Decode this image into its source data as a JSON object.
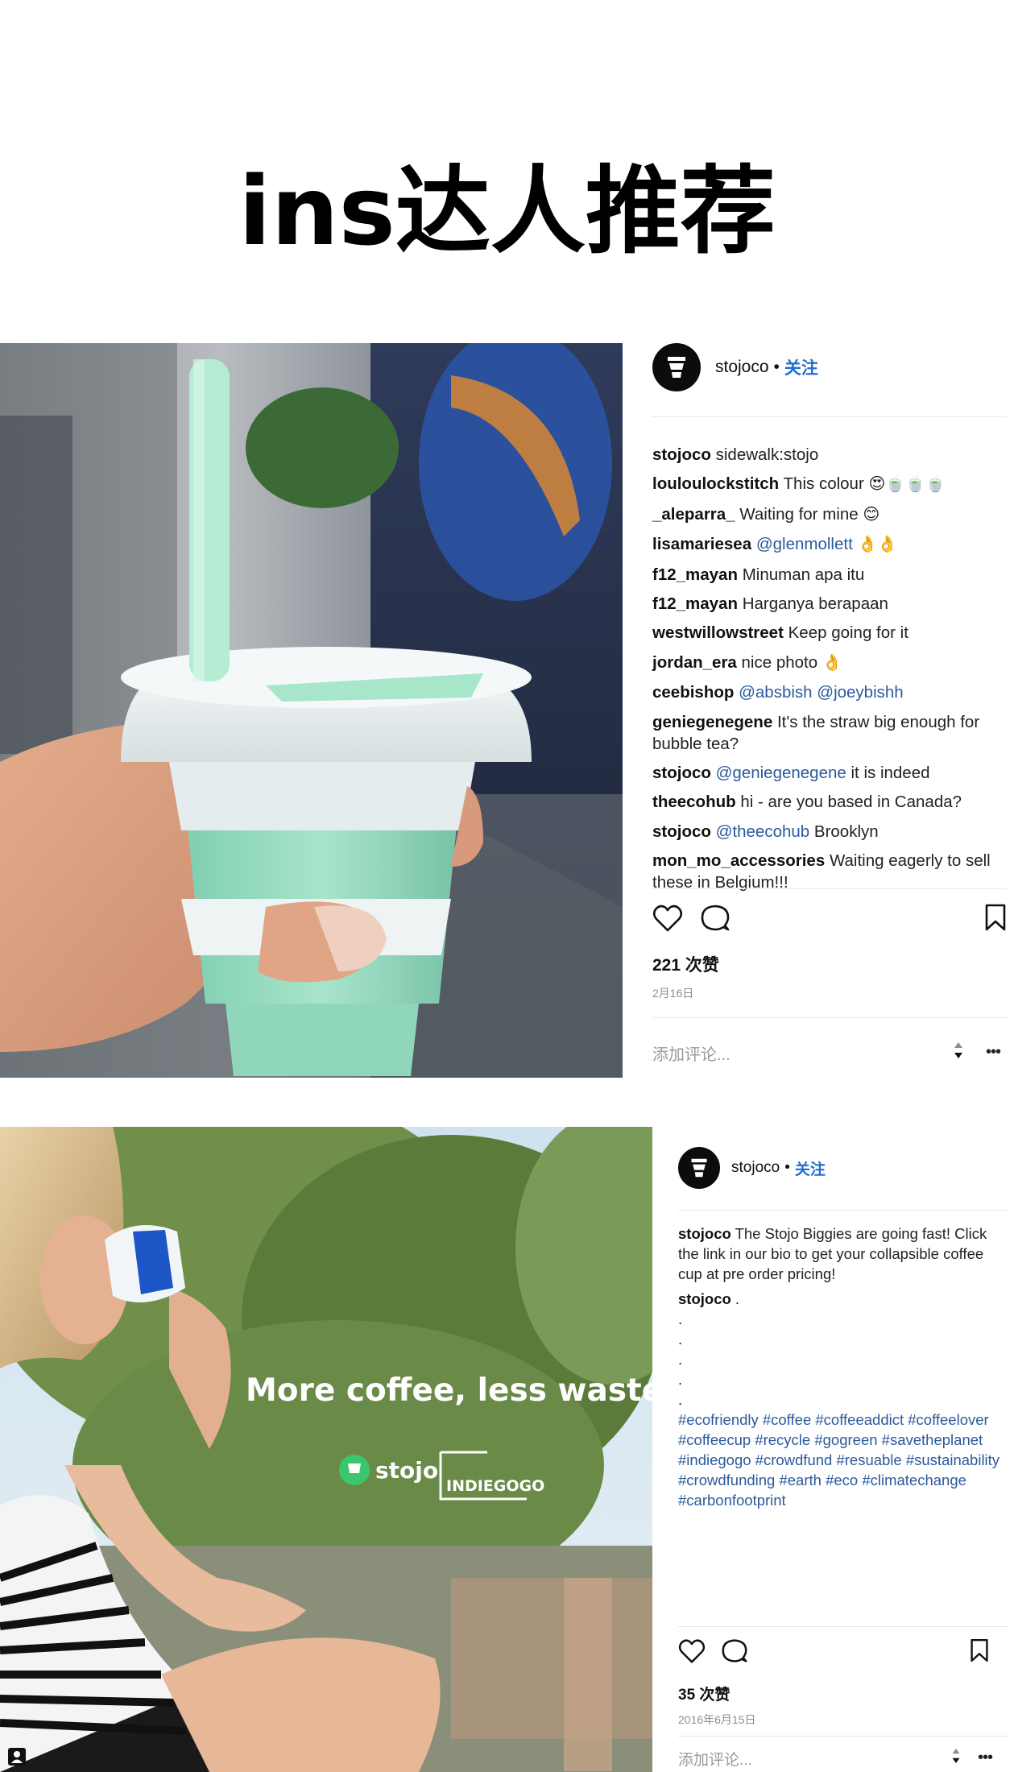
{
  "page": {
    "title": "ins达人推荐"
  },
  "posts": [
    {
      "username": "stojoco",
      "separator": "•",
      "follow": "关注",
      "comments": [
        {
          "user": "stojoco",
          "text": "sidewalk:stojo"
        },
        {
          "user": "louloulockstitch",
          "text": "This colour",
          "emoji": "😍🍵🍵🍵"
        },
        {
          "user": "_aleparra_",
          "text": "Waiting for mine",
          "emoji": "😊"
        },
        {
          "user": "lisamariesea",
          "mention": "@glenmollett",
          "emoji": "👌👌"
        },
        {
          "user": "f12_mayan",
          "text": "Minuman apa itu"
        },
        {
          "user": "f12_mayan",
          "text": "Harganya berapaan"
        },
        {
          "user": "westwillowstreet",
          "text": "Keep going for it"
        },
        {
          "user": "jordan_era",
          "text": "nice photo",
          "emoji": "👌"
        },
        {
          "user": "ceebishop",
          "mention": "@absbish @joeybishh"
        },
        {
          "user": "geniegenegene",
          "text": "It's the straw big enough for bubble tea?"
        },
        {
          "user": "stojoco",
          "mention": "@geniegenegene",
          "text": "it is indeed"
        },
        {
          "user": "theecohub",
          "text": "hi - are you based in Canada?"
        },
        {
          "user": "stojoco",
          "mention": "@theecohub",
          "text": "Brooklyn"
        },
        {
          "user": "mon_mo_accessories",
          "text": "Waiting eagerly to sell these in Belgium!!!"
        }
      ],
      "likes": "221 次赞",
      "date": "2月16日",
      "add_comment": "添加评论...",
      "more": "•••"
    },
    {
      "username": "stojoco",
      "separator": "•",
      "follow": "关注",
      "caption_user": "stojoco",
      "caption_text": "The Stojo Biggies are going fast! Click the link in our bio to get your collapsible coffee cup at pre order pricing!",
      "caption2_user": "stojoco",
      "caption2_text": ".",
      "dots": [
        ".",
        ".",
        ".",
        ".",
        "."
      ],
      "hashtags": "#ecofriendly #coffee #coffeeaddict #coffeelover #coffeecup #recycle #gogreen #savetheplanet #indiegogo #crowdfund #resuable #sustainability #crowdfunding #earth #eco #climatechange #carbonfootprint",
      "likes": "35 次赞",
      "date": "2016年6月15日",
      "add_comment": "添加评论...",
      "more": "•••",
      "photo_overlay": "More coffee, less waste",
      "photo_brand": "stojo",
      "photo_partner": "INDIEGOGO"
    }
  ],
  "colors": {
    "link": "#2a5a9c",
    "follow": "#1f6fd0",
    "mint": "#a9e3c9",
    "cup_white": "#e9eff0"
  }
}
